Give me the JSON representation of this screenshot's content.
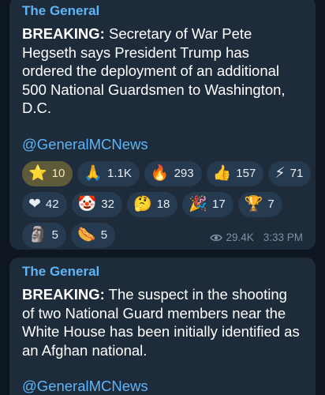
{
  "posts": [
    {
      "channel": "The General",
      "headline": "BREAKING:",
      "body": " Secretary of War Pete Hegseth says President Trump has ordered the deployment of an additional 500 National Guardsmen to Washington, D.C.",
      "link": "@GeneralMCNews",
      "reactions": [
        {
          "icon": "star-icon",
          "emoji": "⭐",
          "count": "10",
          "selected": true
        },
        {
          "icon": "praying-hands-icon",
          "emoji": "🙏",
          "count": "1.1K"
        },
        {
          "icon": "fire-icon",
          "emoji": "🔥",
          "count": "293"
        },
        {
          "icon": "thumbs-up-icon",
          "emoji": "👍",
          "count": "157"
        },
        {
          "icon": "lightning-icon",
          "emoji": "⚡",
          "count": "71"
        },
        {
          "icon": "heart-icon",
          "emoji": "❤",
          "count": "42"
        },
        {
          "icon": "clown-icon",
          "emoji": "🤡",
          "count": "32"
        },
        {
          "icon": "thinking-face-icon",
          "emoji": "🤔",
          "count": "18"
        },
        {
          "icon": "party-popper-icon",
          "emoji": "🎉",
          "count": "17"
        },
        {
          "icon": "trophy-icon",
          "emoji": "🏆",
          "count": "7"
        },
        {
          "icon": "moai-icon",
          "emoji": "🗿",
          "count": "5"
        },
        {
          "icon": "hot-dog-icon",
          "emoji": "🌭",
          "count": "5"
        }
      ],
      "views": "29.4K",
      "time": "3:33 PM"
    },
    {
      "channel": "The General",
      "headline": "BREAKING:",
      "body": " The suspect in the shooting of two National Guard members near the White House has been initially identified as an Afghan national.",
      "link": "@GeneralMCNews"
    }
  ],
  "colors": {
    "background": "#0e1621",
    "bubble": "#1e2b3a",
    "accent": "#5eb5f7",
    "chip": "#263a50",
    "chip_selected": "#5e5a3a"
  }
}
